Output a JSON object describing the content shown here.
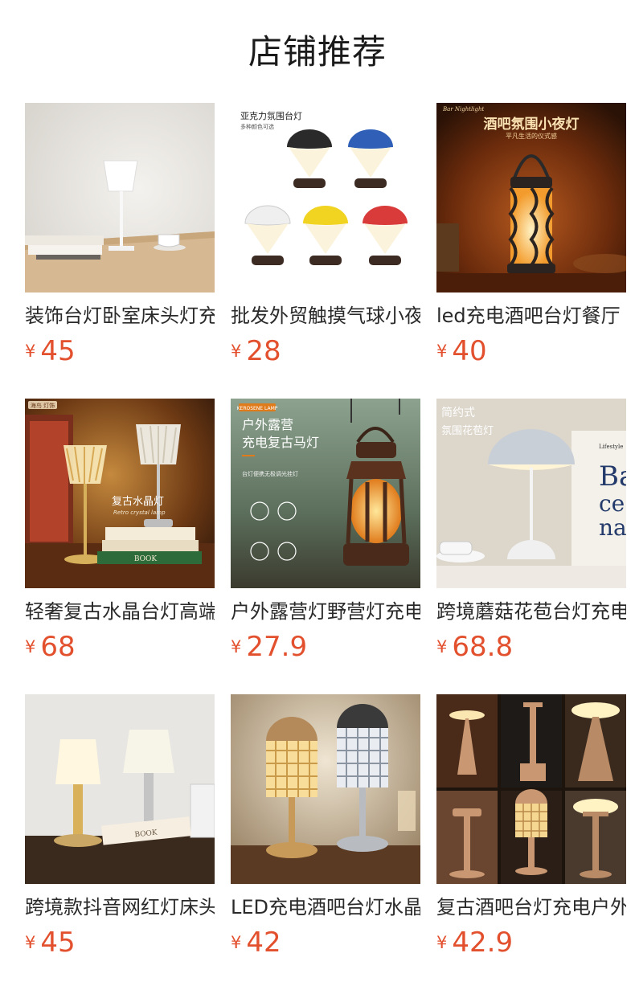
{
  "section_title": "店铺推荐",
  "products": [
    {
      "name": "装饰台灯卧室床头灯充电",
      "currency": "¥",
      "price": "45",
      "image": {
        "text_1": "",
        "text_2": ""
      }
    },
    {
      "name": "批发外贸触摸气球小夜灯",
      "currency": "¥",
      "price": "28",
      "image": {
        "text_1": "亚克力氛围台灯",
        "text_2": "多种颜色可选"
      }
    },
    {
      "name": "led充电酒吧台灯餐厅",
      "currency": "¥",
      "price": "40",
      "image": {
        "text_1": "酒吧氛围小夜灯",
        "text_2": "平凡生活的仪式感",
        "text_3": "Bar Nightlight"
      }
    },
    {
      "name": "轻奢复古水晶台灯高端",
      "currency": "¥",
      "price": "68",
      "image": {
        "text_1": "复古水晶灯",
        "text_2": "Retro crystal lamp",
        "text_3": "海鸟 灯饰",
        "text_4": "BOOK"
      }
    },
    {
      "name": "户外露营灯野营灯充电",
      "currency": "¥",
      "price": "27.9",
      "image": {
        "text_1": "户外露营",
        "text_2": "充电复古马灯",
        "text_3": "KEROSENE LAMP",
        "text_4": "台灯便携无极调光挂灯"
      }
    },
    {
      "name": "跨境蘑菇花苞台灯充电",
      "currency": "¥",
      "price": "68.8",
      "image": {
        "text_1": "简约式",
        "text_2": "氛围花苞灯",
        "text_3": "Lifestyle",
        "text_4": "Ba",
        "text_5": "ce",
        "text_6": "na"
      }
    },
    {
      "name": "跨境款抖音网红灯床头",
      "currency": "¥",
      "price": "45",
      "image": {
        "text_1": "BOOK"
      }
    },
    {
      "name": "LED充电酒吧台灯水晶",
      "currency": "¥",
      "price": "42",
      "image": {}
    },
    {
      "name": "复古酒吧台灯充电户外",
      "currency": "¥",
      "price": "42.9",
      "image": {}
    }
  ],
  "colors": {
    "price": "#e2502e",
    "title": "#1a1a1a",
    "text": "#2a2a2a"
  }
}
